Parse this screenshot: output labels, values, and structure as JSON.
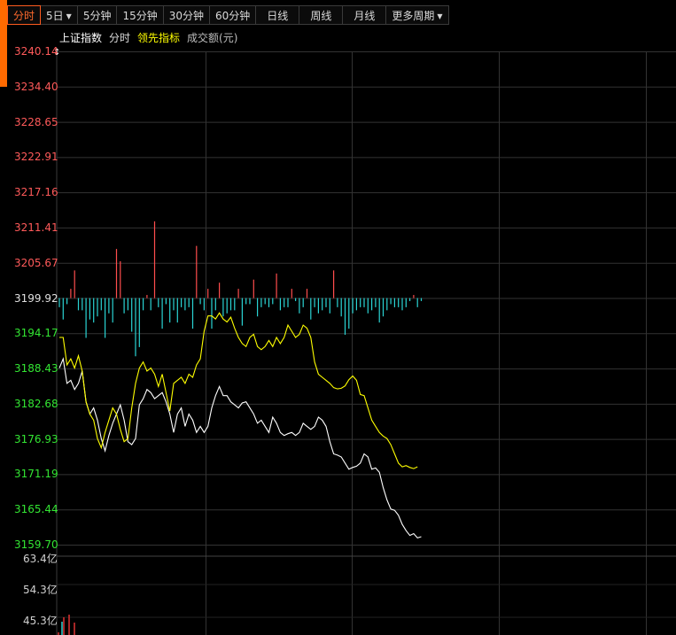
{
  "toolbar": {
    "tabs": [
      {
        "label": "分时",
        "active": true
      },
      {
        "label": "5日",
        "dropdown": true
      },
      {
        "label": "5分钟"
      },
      {
        "label": "15分钟"
      },
      {
        "label": "30分钟"
      },
      {
        "label": "60分钟"
      },
      {
        "label": "日线"
      },
      {
        "label": "周线"
      },
      {
        "label": "月线"
      },
      {
        "label": "更多周期",
        "dropdown": true
      }
    ]
  },
  "legend": {
    "index_name": "上证指数",
    "mode": "分时",
    "lead_index": "领先指标",
    "volume": "成交额(元)"
  },
  "colors": {
    "accent": "#ff6a00",
    "up": "#ff5a5a",
    "down": "#33e633",
    "price_line": "#ffffff",
    "lead_line": "#ffff00",
    "bar_up": "#ff4d4d",
    "bar_down": "#2ad4d4",
    "grid": "#333333"
  },
  "price_axis": {
    "labels": [
      "3240.14",
      "3234.40",
      "3228.65",
      "3222.91",
      "3217.16",
      "3211.41",
      "3205.67",
      "3199.92",
      "3194.17",
      "3188.43",
      "3182.68",
      "3176.93",
      "3171.19",
      "3165.44",
      "3159.70"
    ],
    "prev_close": 3199.92
  },
  "volume_axis": {
    "labels": [
      "63.4亿",
      "54.3亿",
      "45.3亿"
    ]
  },
  "chart_data": {
    "type": "line",
    "ylim": [
      3159.7,
      3240.14
    ],
    "series": [
      {
        "name": "上证指数",
        "color": "#ffffff",
        "values": [
          3188.5,
          3190,
          3186,
          3186.5,
          3185,
          3186,
          3188,
          3183,
          3181,
          3182,
          3180,
          3177,
          3175,
          3177.5,
          3179.5,
          3181,
          3182.5,
          3180,
          3176.5,
          3176,
          3177,
          3182.5,
          3183.5,
          3185,
          3184.5,
          3183.5,
          3184,
          3184.5,
          3183,
          3181,
          3178,
          3181,
          3182,
          3179,
          3181,
          3180,
          3178,
          3179,
          3178,
          3179,
          3182,
          3184,
          3185.5,
          3184,
          3184,
          3183,
          3182.5,
          3182,
          3182.8,
          3183,
          3182,
          3181,
          3179.5,
          3180,
          3179,
          3178,
          3180.5,
          3179.5,
          3178,
          3177.5,
          3177.8,
          3178,
          3177.5,
          3178,
          3179.5,
          3179,
          3178.5,
          3179,
          3180.5,
          3180,
          3179,
          3176.5,
          3174.5,
          3174.3,
          3174,
          3173,
          3172,
          3172.3,
          3172.5,
          3173,
          3174.5,
          3174,
          3172,
          3172.2,
          3171.5,
          3169,
          3167,
          3165.5,
          3165.3,
          3164.5,
          3163,
          3162,
          3161.2,
          3161.5,
          3160.8,
          3161
        ]
      },
      {
        "name": "领先指标",
        "color": "#ffff00",
        "values": [
          3193.5,
          3193.5,
          3189,
          3190,
          3188.5,
          3190.5,
          3188,
          3183,
          3181,
          3180,
          3177,
          3175.5,
          3178,
          3180,
          3182,
          3181,
          3178.5,
          3176.5,
          3177,
          3182,
          3186,
          3188.5,
          3189.5,
          3188,
          3188.5,
          3187.5,
          3185.5,
          3187.5,
          3184.5,
          3181.5,
          3186,
          3186.5,
          3187,
          3186,
          3187.5,
          3187,
          3189,
          3190,
          3194.5,
          3197,
          3197,
          3196.5,
          3197.5,
          3196.5,
          3196,
          3196.8,
          3195,
          3193.5,
          3192.5,
          3192,
          3193.5,
          3194,
          3192,
          3191.5,
          3192,
          3193,
          3192,
          3193.5,
          3192.5,
          3193.5,
          3195.5,
          3194.5,
          3193.5,
          3194,
          3195.5,
          3195,
          3193.5,
          3189.5,
          3187.5,
          3187,
          3186.5,
          3186,
          3185.3,
          3185.1,
          3185.2,
          3185.6,
          3186.6,
          3187.2,
          3186.5,
          3184.2,
          3184,
          3182,
          3180,
          3179,
          3178,
          3177.4,
          3177,
          3176,
          3174.5,
          3173,
          3172.4,
          3172.6,
          3172.3,
          3172.1,
          3172.4
        ]
      }
    ],
    "volume_bars": [
      -1.5,
      -3.5,
      -1,
      1.5,
      4.5,
      -2,
      -2,
      -6.5,
      -3.5,
      -4,
      -3,
      -2,
      -6.5,
      -2.5,
      -4,
      8,
      6,
      -2.5,
      -2,
      -5.5,
      -9.5,
      -8,
      -2,
      0.5,
      -2,
      12.5,
      -1.5,
      -5,
      -1,
      -4,
      -2,
      -4,
      -1.5,
      -2,
      -1.5,
      -5,
      8.5,
      -1,
      -2,
      1.5,
      -5,
      -2,
      2.5,
      -3,
      -2.5,
      -2,
      -2,
      1.5,
      -4.5,
      -1,
      -1,
      3,
      -3,
      -1.5,
      -1,
      -1.5,
      -1,
      4,
      -2,
      -1.5,
      -1.5,
      1.5,
      -0.5,
      -2.5,
      -1.5,
      1.5,
      -3.5,
      -1.5,
      -2.5,
      -2,
      -1.5,
      -2.5,
      4.5,
      -1.5,
      -3,
      -6,
      -5,
      -2.5,
      -2,
      -1.5,
      -1.5,
      -2.5,
      -2,
      -1.5,
      -4,
      -3,
      -2,
      -1,
      -1.5,
      -1.5,
      -2,
      -1.5,
      -0.5,
      0.5,
      -1.5,
      -0.5
    ]
  }
}
